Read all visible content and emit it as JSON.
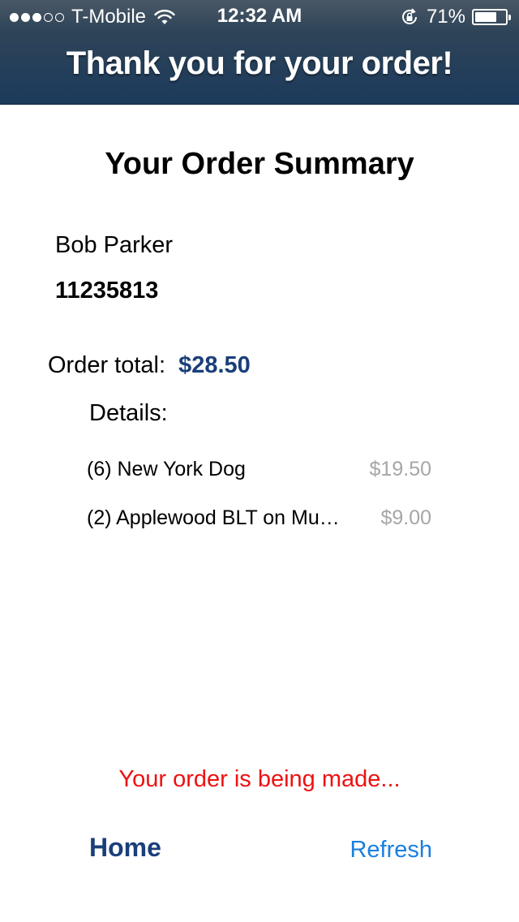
{
  "status_bar": {
    "carrier": "T-Mobile",
    "signal_bars_filled": 3,
    "signal_bars_total": 5,
    "time": "12:32 AM",
    "battery_percent": "71%",
    "battery_level": 0.71
  },
  "header": {
    "title": "Thank you for your order!"
  },
  "summary": {
    "title": "Your Order Summary",
    "customer_name": "Bob Parker",
    "order_number": "11235813",
    "total_label": "Order total:",
    "total_value": "$28.50",
    "details_label": "Details:",
    "items": [
      {
        "name": "(6) New York Dog",
        "price": "$19.50"
      },
      {
        "name": "(2) Applewood BLT on Mu…",
        "price": "$9.00"
      }
    ]
  },
  "status_message": "Your order is being made...",
  "actions": {
    "home_label": "Home",
    "refresh_label": "Refresh"
  },
  "colors": {
    "header_bg": "#1c3a5c",
    "accent_blue": "#1a3f7a",
    "link_blue": "#1a7fe0",
    "alert_red": "#ee1111",
    "price_gray": "#a6a6a6"
  }
}
